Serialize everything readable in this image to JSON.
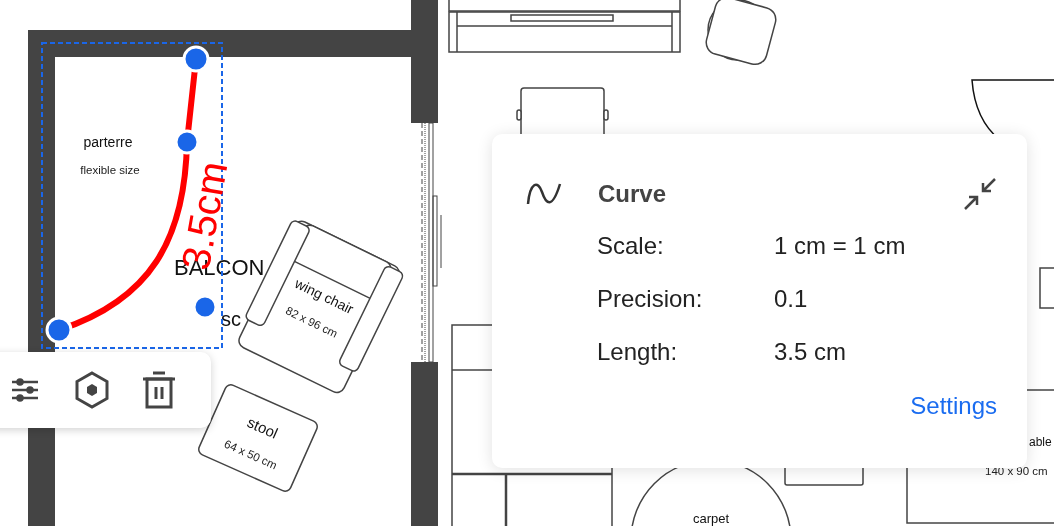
{
  "plan": {
    "parterre": {
      "name": "parterre",
      "note": "flexible size"
    },
    "room": {
      "name": "BALCON",
      "area": "sc"
    },
    "measurement": "3.5cm",
    "wing_chair": {
      "name": "wing chair",
      "size": "82 x 96 cm"
    },
    "stool": {
      "name": "stool",
      "size": "64 x 50 cm"
    },
    "carpet": {
      "name": "carpet"
    },
    "table": {
      "name": "able",
      "size": "140 x 90 cm"
    }
  },
  "toolbar": {
    "buttons": [
      {
        "kind": "adjust"
      },
      {
        "kind": "hexagon"
      },
      {
        "kind": "delete"
      }
    ]
  },
  "panel": {
    "title": "Curve",
    "rows": [
      {
        "label": "Scale:",
        "value": "1 cm = 1 cm"
      },
      {
        "label": "Precision:",
        "value": "0.1"
      },
      {
        "label": "Length:",
        "value": "3.5 cm"
      }
    ],
    "link": "Settings"
  }
}
